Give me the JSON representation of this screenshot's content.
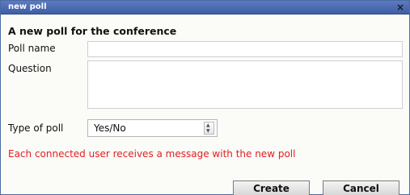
{
  "window": {
    "title": "new poll",
    "close_glyph": "×",
    "close_icon": "close-icon"
  },
  "form": {
    "heading": "A new poll for the conference",
    "poll_name_label": "Poll name",
    "poll_name_value": "",
    "question_label": "Question",
    "question_value": "",
    "type_label": "Type of poll",
    "type_selected": "Yes/No",
    "notice": "Each connected user receives a message with the new poll",
    "notice_color": "#e02020"
  },
  "buttons": {
    "create": "Create",
    "cancel": "Cancel"
  },
  "colors": {
    "titlebar": "#4a6aa4",
    "dialog_bg": "#fbfbf8"
  }
}
